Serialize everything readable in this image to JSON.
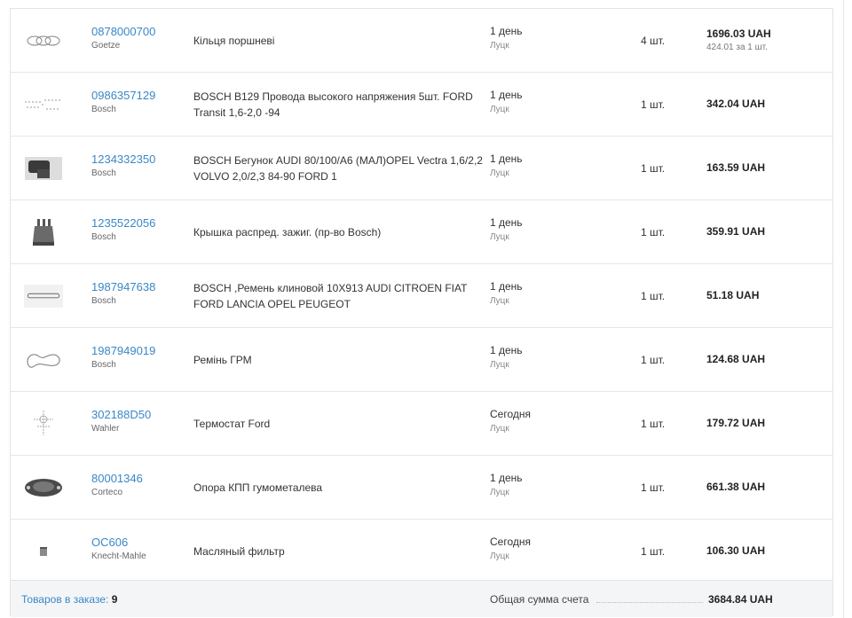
{
  "items": [
    {
      "code": "0878000700",
      "brand": "Goetze",
      "name": "Кільця поршневі",
      "delivery": "1 день",
      "city": "Луцк",
      "qty": "4 шт.",
      "total": "1696.03 UAH",
      "unit": "424.01 за 1 шт.",
      "icon": "piston-rings-icon"
    },
    {
      "code": "0986357129",
      "brand": "Bosch",
      "name": "BOSCH B129 Провода высокого напряжения 5шт. FORD Transit 1,6-2,0 -94",
      "delivery": "1 день",
      "city": "Луцк",
      "qty": "1 шт.",
      "total": "342.04 UAH",
      "unit": "",
      "icon": "ignition-wires-icon"
    },
    {
      "code": "1234332350",
      "brand": "Bosch",
      "name": "BOSCH Бегунок AUDI 80/100/A6 (МАЛ)OPEL Vectra 1,6/2,2 VOLVO 2,0/2,3 84-90 FORD 1",
      "delivery": "1 день",
      "city": "Луцк",
      "qty": "1 шт.",
      "total": "163.59 UAH",
      "unit": "",
      "icon": "distributor-rotor-icon"
    },
    {
      "code": "1235522056",
      "brand": "Bosch",
      "name": "Крышка распред. зажиг. (пр-во Bosch)",
      "delivery": "1 день",
      "city": "Луцк",
      "qty": "1 шт.",
      "total": "359.91 UAH",
      "unit": "",
      "icon": "distributor-cap-icon"
    },
    {
      "code": "1987947638",
      "brand": "Bosch",
      "name": "BOSCH ,Ремень клиновой 10X913 AUDI CITROEN FIAT FORD LANCIA OPEL PEUGEOT",
      "delivery": "1 день",
      "city": "Луцк",
      "qty": "1 шт.",
      "total": "51.18 UAH",
      "unit": "",
      "icon": "v-belt-icon"
    },
    {
      "code": "1987949019",
      "brand": "Bosch",
      "name": "Ремінь ГРМ",
      "delivery": "1 день",
      "city": "Луцк",
      "qty": "1 шт.",
      "total": "124.68 UAH",
      "unit": "",
      "icon": "timing-belt-icon"
    },
    {
      "code": "302188D50",
      "brand": "Wahler",
      "name": "Термостат Ford",
      "delivery": "Сегодня",
      "city": "Луцк",
      "qty": "1 шт.",
      "total": "179.72 UAH",
      "unit": "",
      "icon": "thermostat-icon"
    },
    {
      "code": "80001346",
      "brand": "Corteco",
      "name": "Опора КПП гумометалева",
      "delivery": "1 день",
      "city": "Луцк",
      "qty": "1 шт.",
      "total": "661.38 UAH",
      "unit": "",
      "icon": "gearbox-mount-icon"
    },
    {
      "code": "OC606",
      "brand": "Knecht-Mahle",
      "name": "Масляный фильтр",
      "delivery": "Сегодня",
      "city": "Луцк",
      "qty": "1 шт.",
      "total": "106.30 UAH",
      "unit": "",
      "icon": "oil-filter-icon"
    }
  ],
  "footer": {
    "count_label": "Товаров в заказе:",
    "count_value": "9",
    "sum_label": "Общая сумма счета",
    "sum_value": "3684.84 UAH"
  },
  "colors": {
    "link": "#3a87c8",
    "footer_bg": "#f4f5f7",
    "border": "#e6e6e6"
  }
}
